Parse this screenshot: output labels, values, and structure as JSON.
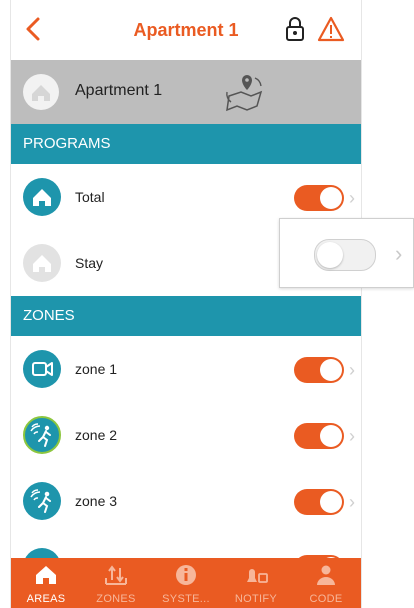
{
  "header": {
    "title": "Apartment 1",
    "back_icon": "chevron-left-icon",
    "lock_icon": "lock-icon",
    "warning_icon": "warning-icon"
  },
  "area": {
    "name": "Apartment 1",
    "icon": "home-icon",
    "map_icon": "map-pin-icon"
  },
  "programs": {
    "title": "PROGRAMS",
    "items": [
      {
        "label": "Total",
        "icon": "home-icon",
        "on": true
      },
      {
        "label": "Stay",
        "icon": "home-icon",
        "on": false
      }
    ]
  },
  "zones": {
    "title": "ZONES",
    "items": [
      {
        "label": "zone 1",
        "icon": "camera-icon",
        "on": true
      },
      {
        "label": "zone 2",
        "icon": "motion-sensor-icon",
        "on": true
      },
      {
        "label": "zone 3",
        "icon": "motion-sensor-icon",
        "on": true
      }
    ]
  },
  "popup": {
    "toggle_on": false
  },
  "bottom_nav": {
    "items": [
      {
        "label": "AREAS",
        "icon": "home-icon",
        "active": true
      },
      {
        "label": "ZONES",
        "icon": "zones-icon",
        "active": false
      },
      {
        "label": "SYSTE...",
        "icon": "info-icon",
        "active": false
      },
      {
        "label": "NOTIFY",
        "icon": "notify-icon",
        "active": false
      },
      {
        "label": "CODE",
        "icon": "user-icon",
        "active": false
      }
    ]
  },
  "colors": {
    "accent": "#ea5b22",
    "section": "#1e95ac",
    "area_bar": "#bdbdbd"
  }
}
